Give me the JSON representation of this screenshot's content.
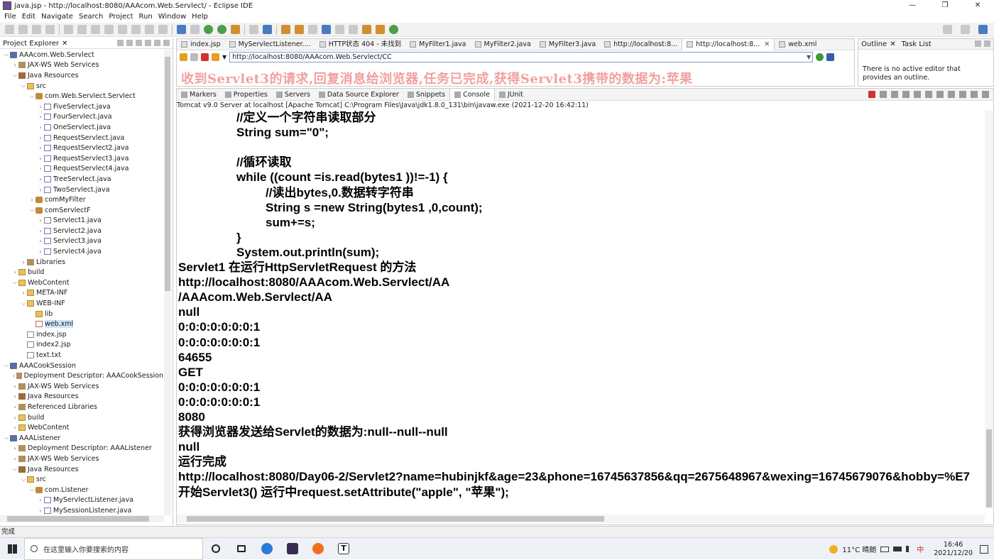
{
  "window": {
    "title": "java.jsp - http://localhost:8080/AAAcom.Web.Servlect/ - Eclipse IDE",
    "minimize": "—",
    "maximize": "❐",
    "close": "✕"
  },
  "menu": [
    "File",
    "Edit",
    "Navigate",
    "Search",
    "Project",
    "Run",
    "Window",
    "Help"
  ],
  "explorer": {
    "title": "Project Explorer",
    "items": [
      {
        "label": "AAAcom.Web.Servlect",
        "depth": 0,
        "arrow": "v",
        "icon": "proj"
      },
      {
        "label": "JAX-WS Web Services",
        "depth": 1,
        "arrow": ">",
        "icon": "lib"
      },
      {
        "label": "Java Resources",
        "depth": 1,
        "arrow": "v",
        "icon": "jar"
      },
      {
        "label": "src",
        "depth": 2,
        "arrow": "v",
        "icon": "fold"
      },
      {
        "label": "com.Web.Servlect.Servlect",
        "depth": 3,
        "arrow": "v",
        "icon": "pkg"
      },
      {
        "label": "FiveServlect.java",
        "depth": 4,
        "arrow": ">",
        "icon": "java"
      },
      {
        "label": "FourServlect.java",
        "depth": 4,
        "arrow": ">",
        "icon": "java"
      },
      {
        "label": "OneServlect.java",
        "depth": 4,
        "arrow": ">",
        "icon": "java"
      },
      {
        "label": "RequestServlect.java",
        "depth": 4,
        "arrow": ">",
        "icon": "java"
      },
      {
        "label": "RequestServlect2.java",
        "depth": 4,
        "arrow": ">",
        "icon": "java"
      },
      {
        "label": "RequestServlect3.java",
        "depth": 4,
        "arrow": ">",
        "icon": "java"
      },
      {
        "label": "RequestServlect4.java",
        "depth": 4,
        "arrow": ">",
        "icon": "java"
      },
      {
        "label": "TreeServlect.java",
        "depth": 4,
        "arrow": ">",
        "icon": "java"
      },
      {
        "label": "TwoServlect.java",
        "depth": 4,
        "arrow": ">",
        "icon": "java"
      },
      {
        "label": "comMyFilter",
        "depth": 3,
        "arrow": ">",
        "icon": "pkg"
      },
      {
        "label": "comServlectF",
        "depth": 3,
        "arrow": "v",
        "icon": "pkg"
      },
      {
        "label": "Servlect1.java",
        "depth": 4,
        "arrow": ">",
        "icon": "java"
      },
      {
        "label": "Servlect2.java",
        "depth": 4,
        "arrow": ">",
        "icon": "java"
      },
      {
        "label": "Servlect3.java",
        "depth": 4,
        "arrow": ">",
        "icon": "java"
      },
      {
        "label": "Servlect4.java",
        "depth": 4,
        "arrow": ">",
        "icon": "java"
      },
      {
        "label": "Libraries",
        "depth": 2,
        "arrow": ">",
        "icon": "lib"
      },
      {
        "label": "build",
        "depth": 1,
        "arrow": ">",
        "icon": "fold"
      },
      {
        "label": "WebContent",
        "depth": 1,
        "arrow": "v",
        "icon": "fold"
      },
      {
        "label": "META-INF",
        "depth": 2,
        "arrow": ">",
        "icon": "fold"
      },
      {
        "label": "WEB-INF",
        "depth": 2,
        "arrow": "v",
        "icon": "fold"
      },
      {
        "label": "lib",
        "depth": 3,
        "arrow": "",
        "icon": "fold"
      },
      {
        "label": "web.xml",
        "depth": 3,
        "arrow": "",
        "icon": "xml",
        "selected": true
      },
      {
        "label": "index.jsp",
        "depth": 2,
        "arrow": "",
        "icon": "jsp"
      },
      {
        "label": "index2.jsp",
        "depth": 2,
        "arrow": "",
        "icon": "jsp"
      },
      {
        "label": "text.txt",
        "depth": 2,
        "arrow": "",
        "icon": "jsp"
      },
      {
        "label": "AAACookSession",
        "depth": 0,
        "arrow": "v",
        "icon": "proj"
      },
      {
        "label": "Deployment Descriptor: AAACookSession",
        "depth": 1,
        "arrow": ">",
        "icon": "lib"
      },
      {
        "label": "JAX-WS Web Services",
        "depth": 1,
        "arrow": ">",
        "icon": "lib"
      },
      {
        "label": "Java Resources",
        "depth": 1,
        "arrow": ">",
        "icon": "jar"
      },
      {
        "label": "Referenced Libraries",
        "depth": 1,
        "arrow": ">",
        "icon": "lib"
      },
      {
        "label": "build",
        "depth": 1,
        "arrow": ">",
        "icon": "fold"
      },
      {
        "label": "WebContent",
        "depth": 1,
        "arrow": ">",
        "icon": "fold"
      },
      {
        "label": "AAAListener",
        "depth": 0,
        "arrow": "v",
        "icon": "proj"
      },
      {
        "label": "Deployment Descriptor: AAAListener",
        "depth": 1,
        "arrow": ">",
        "icon": "lib"
      },
      {
        "label": "JAX-WS Web Services",
        "depth": 1,
        "arrow": ">",
        "icon": "lib"
      },
      {
        "label": "Java Resources",
        "depth": 1,
        "arrow": "v",
        "icon": "jar"
      },
      {
        "label": "src",
        "depth": 2,
        "arrow": "v",
        "icon": "fold"
      },
      {
        "label": "com.Listener",
        "depth": 3,
        "arrow": "v",
        "icon": "pkg"
      },
      {
        "label": "MyServlectListener.java",
        "depth": 4,
        "arrow": ">",
        "icon": "java"
      },
      {
        "label": "MySessionListener.java",
        "depth": 4,
        "arrow": ">",
        "icon": "java"
      }
    ]
  },
  "editor": {
    "tabs": [
      {
        "label": "index.jsp",
        "active": false
      },
      {
        "label": "MyServlectListener....",
        "active": false
      },
      {
        "label": "HTTP状态 404 - 未找到",
        "active": false
      },
      {
        "label": "MyFilter1.java",
        "active": false
      },
      {
        "label": "MyFilter2.java",
        "active": false
      },
      {
        "label": "MyFilter3.java",
        "active": false
      },
      {
        "label": "http://localhost:8...",
        "active": false
      },
      {
        "label": "http://localhost:8...",
        "active": true
      },
      {
        "label": "web.xml",
        "active": false
      }
    ],
    "url": "http://localhost:8080/AAAcom.Web.Servlect/CC",
    "page_text": "收到Servlet3的请求,回复消息给浏览器,任务已完成,获得Servlet3携带的数据为:苹果"
  },
  "outline": {
    "tab1": "Outline",
    "tab2": "Task List",
    "message": "There is no active editor that provides an outline."
  },
  "console": {
    "tabs": [
      "Markers",
      "Properties",
      "Servers",
      "Data Source Explorer",
      "Snippets",
      "Console",
      "JUnit"
    ],
    "active_tab": "Console",
    "status": "Tomcat v9.0 Server at localhost [Apache Tomcat] C:\\Program Files\\Java\\jdk1.8.0_131\\bin\\javaw.exe  (2021-12-20 16:42:11)",
    "lines": [
      {
        "text": "//定义一个字符串读取部分",
        "indent": 82
      },
      {
        "text": "String sum=\"0\";",
        "indent": 82
      },
      {
        "text": "",
        "indent": 0
      },
      {
        "text": "//循环读取",
        "indent": 82
      },
      {
        "text": "while ((count =is.read(bytes1 ))!=-1) {",
        "indent": 82
      },
      {
        "text": "//读出bytes,0.数据转字符串",
        "indent": 123
      },
      {
        "text": "String s =new String(bytes1 ,0,count);",
        "indent": 123
      },
      {
        "text": "sum+=s;",
        "indent": 123
      },
      {
        "text": "}",
        "indent": 82
      },
      {
        "text": "System.out.println(sum);",
        "indent": 82
      },
      {
        "text": "Servlet1 在运行HttpServletRequest 的方法",
        "indent": 0
      },
      {
        "text": "http://localhost:8080/AAAcom.Web.Servlect/AA",
        "indent": 0
      },
      {
        "text": "/AAAcom.Web.Servlect/AA",
        "indent": 0
      },
      {
        "text": "null",
        "indent": 0
      },
      {
        "text": "0:0:0:0:0:0:0:1",
        "indent": 0
      },
      {
        "text": "0:0:0:0:0:0:0:1",
        "indent": 0
      },
      {
        "text": "64655",
        "indent": 0
      },
      {
        "text": "GET",
        "indent": 0
      },
      {
        "text": "0:0:0:0:0:0:0:1",
        "indent": 0
      },
      {
        "text": "0:0:0:0:0:0:0:1",
        "indent": 0
      },
      {
        "text": "8080",
        "indent": 0
      },
      {
        "text": "获得浏览器发送给Servlet的数据为:null--null--null",
        "indent": 0
      },
      {
        "text": "null",
        "indent": 0
      },
      {
        "text": "运行完成",
        "indent": 0
      },
      {
        "text": "http://localhost:8080/Day06-2/Servlet2?name=hubinjkf&age=23&phone=16745637856&qq=2675648967&wexing=16745679076&hobby=%E7",
        "indent": 0
      },
      {
        "text": " 开始Servlet3() 运行中request.setAttribute(\"apple\", \"苹果\");",
        "indent": 0
      }
    ]
  },
  "statusbar": {
    "text": "完成"
  },
  "taskbar": {
    "search_placeholder": "在这里输入你要搜索的内容",
    "weather": "11°C  晴朗",
    "time": "16:46",
    "date": "2021/12/20",
    "ime": "中"
  }
}
